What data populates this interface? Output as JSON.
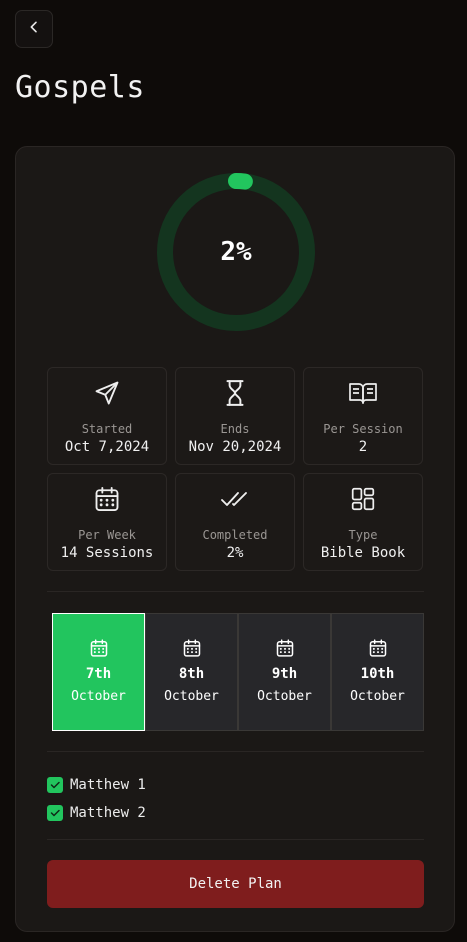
{
  "header": {
    "back_icon": "chevron-left-icon",
    "title": "Gospels"
  },
  "progress": {
    "label": "2%",
    "value_percent": 2,
    "track_color": "#14351f",
    "fill_color": "#22c55e"
  },
  "stats": [
    {
      "icon": "send-icon",
      "label": "Started",
      "value": "Oct 7,2024"
    },
    {
      "icon": "hourglass-icon",
      "label": "Ends",
      "value": "Nov 20,2024"
    },
    {
      "icon": "book-open-icon",
      "label": "Per Session",
      "value": "2"
    },
    {
      "icon": "calendar-icon",
      "label": "Per Week",
      "value": "14 Sessions"
    },
    {
      "icon": "check-check-icon",
      "label": "Completed",
      "value": "2%"
    },
    {
      "icon": "layout-grid-icon",
      "label": "Type",
      "value": "Bible Book"
    }
  ],
  "days": [
    {
      "day": "7th",
      "month": "October",
      "selected": true
    },
    {
      "day": "8th",
      "month": "October",
      "selected": false
    },
    {
      "day": "9th",
      "month": "October",
      "selected": false
    },
    {
      "day": "10th",
      "month": "October",
      "selected": false
    }
  ],
  "tasks": [
    {
      "label": "Matthew 1",
      "checked": true
    },
    {
      "label": "Matthew 2",
      "checked": true
    }
  ],
  "actions": {
    "delete_label": "Delete Plan",
    "delete_color": "#7f1d1d"
  },
  "colors": {
    "accent": "#22c55e",
    "background": "#0e0b09",
    "card": "#1b1816"
  }
}
